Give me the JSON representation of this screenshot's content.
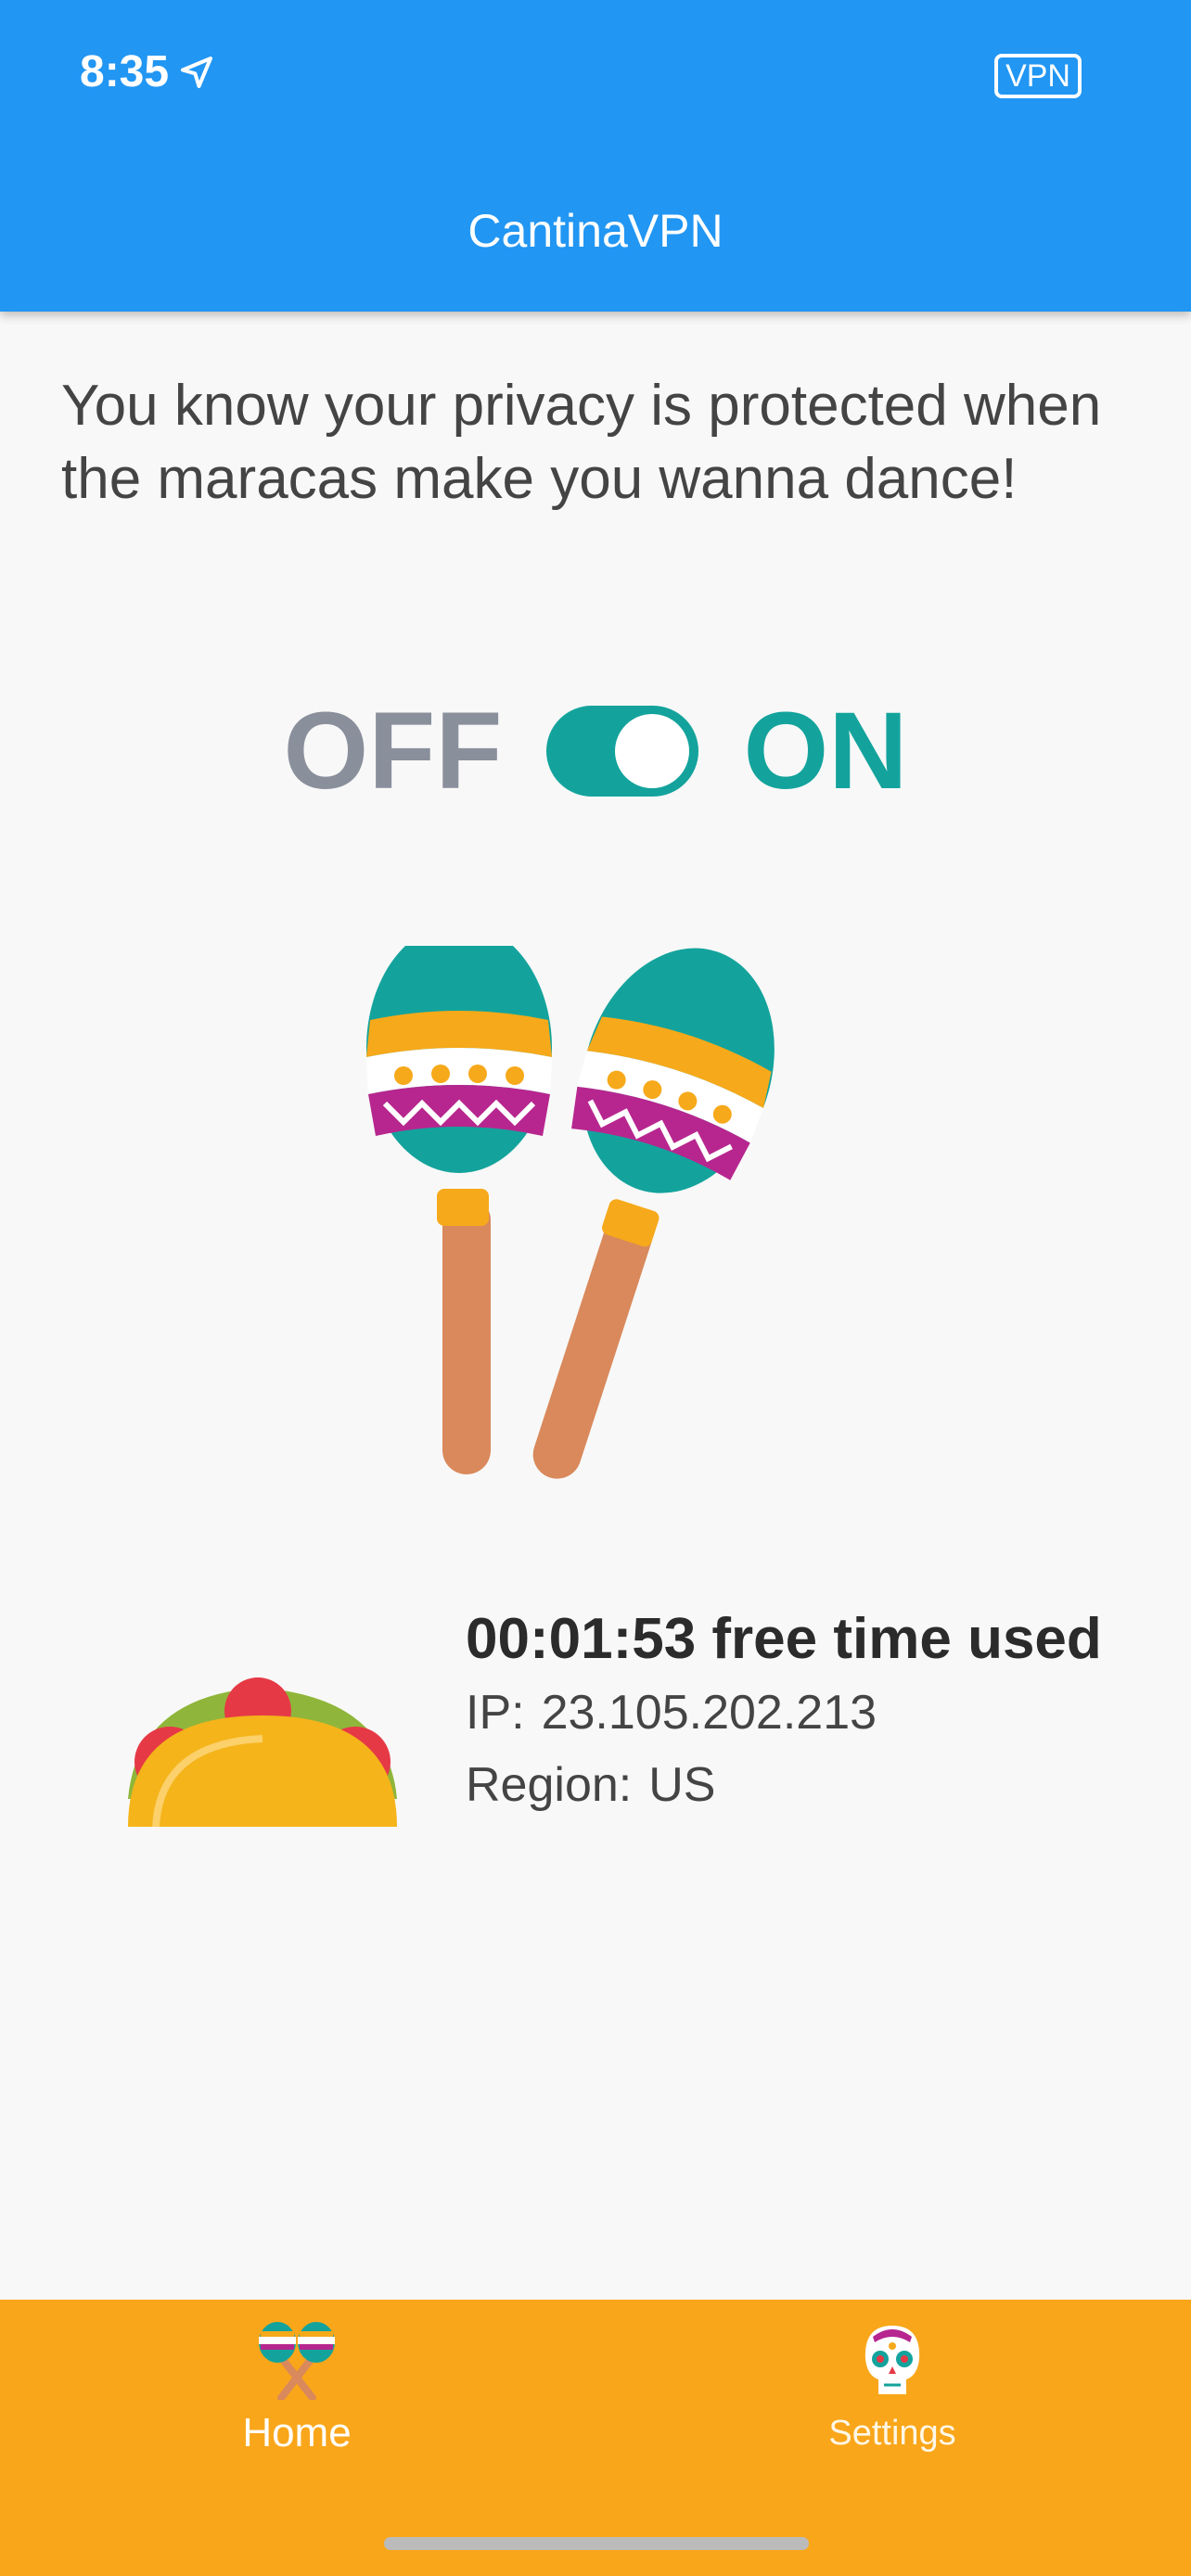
{
  "status_bar": {
    "time": "8:35",
    "location_icon": "location-arrow-icon",
    "vpn_badge": "VPN"
  },
  "app_bar": {
    "title": "CantinaVPN",
    "color": "#2196f3"
  },
  "tagline": "You know your privacy is protected when the maracas make you wanna dance!",
  "toggle": {
    "off_label": "OFF",
    "on_label": "ON",
    "state": "on",
    "accent": "#13a39c"
  },
  "illustrations": {
    "hero": "maracas-icon",
    "status": "taco-icon"
  },
  "stats": {
    "time_used": "00:01:53 free time used",
    "ip_label": "IP:",
    "ip_value": "23.105.202.213",
    "region_label": "Region:",
    "region_value": "US"
  },
  "bottom_nav": {
    "color": "#f9a61a",
    "items": [
      {
        "label": "Home",
        "icon": "maracas-icon",
        "active": true
      },
      {
        "label": "Settings",
        "icon": "sugar-skull-icon",
        "active": false
      }
    ]
  }
}
